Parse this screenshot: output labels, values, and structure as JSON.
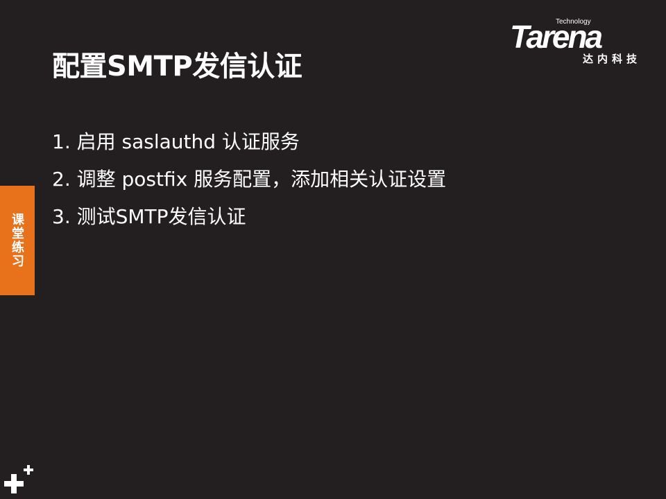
{
  "slide": {
    "title": "配置SMTP发信认证",
    "steps": [
      "1. 启用 saslauthd 认证服务",
      "2. 调整 postfix 服务配置，添加相关认证设置",
      "3. 测试SMTP发信认证"
    ]
  },
  "logo": {
    "tagline": "Technology",
    "wordmark": "Tarena",
    "chinese": "达内科技"
  },
  "side_tab": {
    "label": "课堂练习",
    "color": "#e8711c"
  },
  "theme": {
    "background": "#231f20",
    "text": "#ffffff"
  },
  "icons": {
    "corner": "plus-icon"
  }
}
